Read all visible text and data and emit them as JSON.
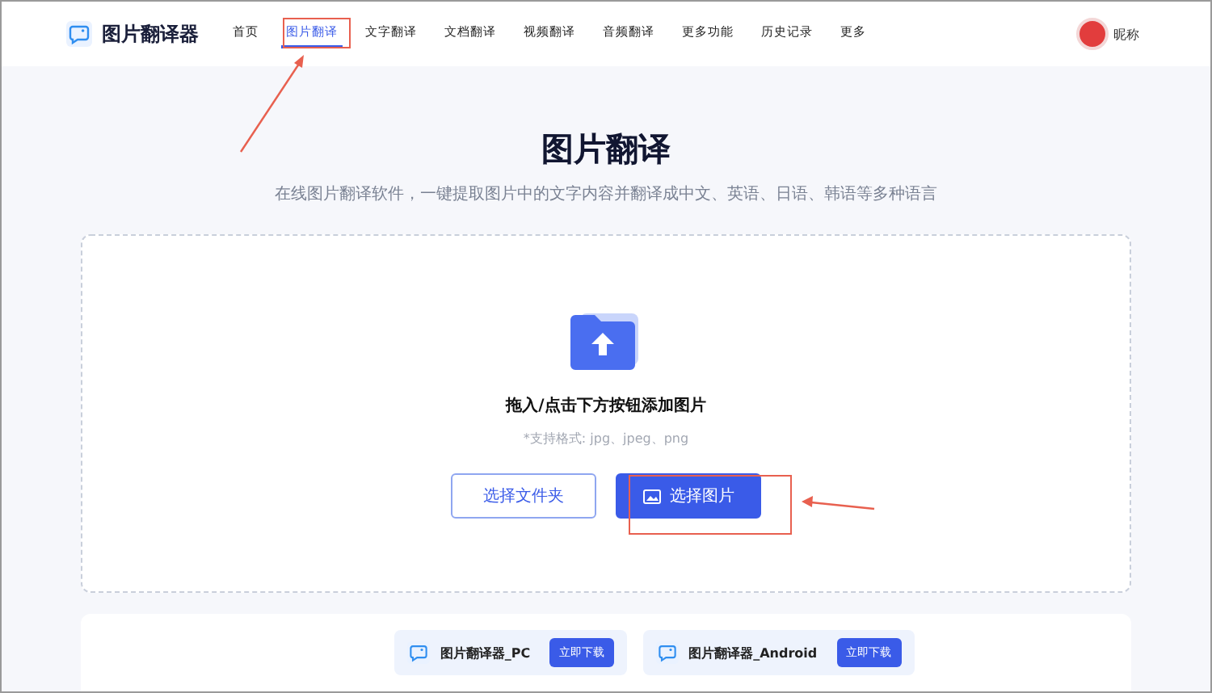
{
  "header": {
    "app_name": "图片翻译器",
    "nav": [
      {
        "label": "首页",
        "selected": false
      },
      {
        "label": "图片翻译",
        "selected": true
      },
      {
        "label": "文字翻译",
        "selected": false
      },
      {
        "label": "文档翻译",
        "selected": false
      },
      {
        "label": "视频翻译",
        "selected": false
      },
      {
        "label": "音频翻译",
        "selected": false
      },
      {
        "label": "更多功能",
        "selected": false
      },
      {
        "label": "历史记录",
        "selected": false
      },
      {
        "label": "更多",
        "selected": false
      }
    ],
    "user": {
      "nickname": "昵称"
    }
  },
  "hero": {
    "title": "图片翻译",
    "subtitle": "在线图片翻译软件，一键提取图片中的文字内容并翻译成中文、英语、日语、韩语等多种语言"
  },
  "upload": {
    "instruction": "拖入/点击下方按钮添加图片",
    "formats": "*支持格式: jpg、jpeg、png",
    "buttons": [
      {
        "label": "选择文件夹",
        "kind": "outline"
      },
      {
        "label": "选择图片",
        "kind": "primary"
      }
    ]
  },
  "downloads": [
    {
      "name": "图片翻译器_PC",
      "button": "立即下载"
    },
    {
      "name": "图片翻译器_Android",
      "button": "立即下载"
    }
  ]
}
